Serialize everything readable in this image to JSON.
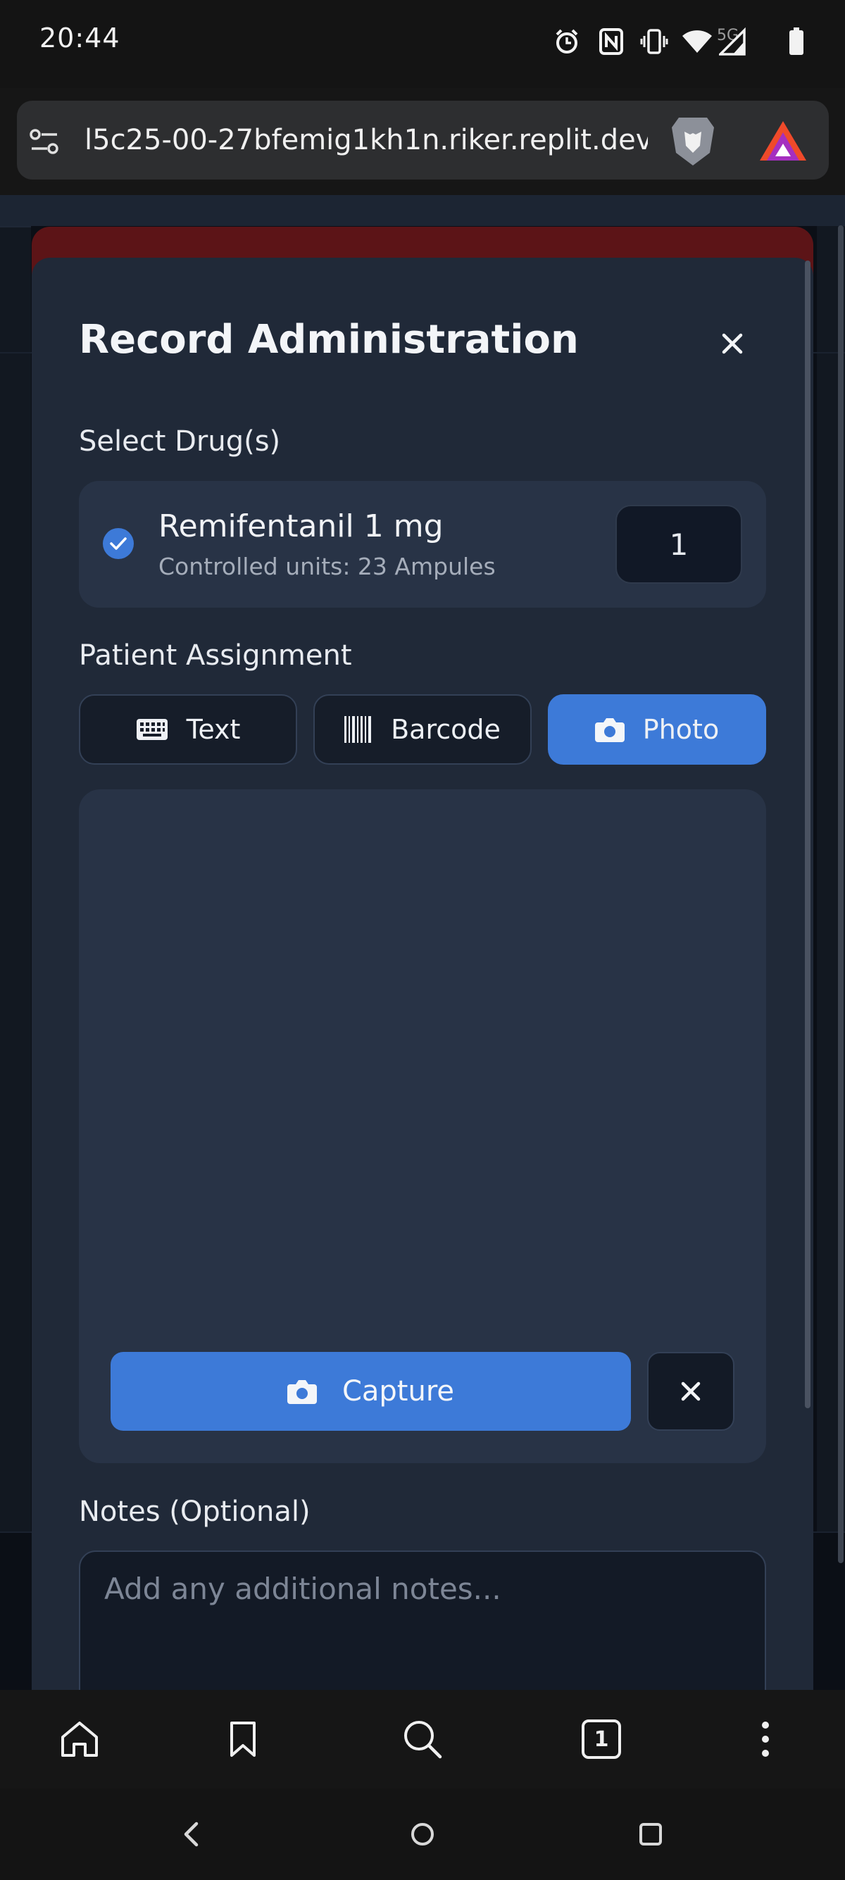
{
  "status_bar": {
    "time": "20:44",
    "network_label": "5G",
    "icons": [
      "alarm-icon",
      "nfc-icon",
      "vibrate-icon",
      "wifi-icon",
      "signal-icon",
      "battery-icon"
    ]
  },
  "browser": {
    "url": "l5c25-00-27bfemig1kh1n.riker.replit.dev",
    "toolbar": {
      "tabs_count": "1",
      "icons": [
        "home-icon",
        "bookmark-icon",
        "search-icon",
        "tabs-icon",
        "more-icon"
      ]
    }
  },
  "modal": {
    "title": "Record Administration",
    "select_drugs_label": "Select Drug(s)",
    "drug": {
      "name": "Remifentanil 1 mg",
      "subtitle": "Controlled units: 23 Ampules",
      "quantity": "1",
      "checked": true
    },
    "patient_assignment_label": "Patient Assignment",
    "tabs": [
      {
        "label": "Text",
        "icon": "keyboard-icon",
        "active": false
      },
      {
        "label": "Barcode",
        "icon": "barcode-icon",
        "active": false
      },
      {
        "label": "Photo",
        "icon": "camera-icon",
        "active": true
      }
    ],
    "capture_label": "Capture",
    "notes_label": "Notes (Optional)",
    "notes_placeholder": "Add any additional notes..."
  },
  "colors": {
    "accent": "#3d7ad8",
    "modal_bg": "#202938",
    "card_bg": "#283346",
    "modal_edge_red": "#5c1417"
  }
}
